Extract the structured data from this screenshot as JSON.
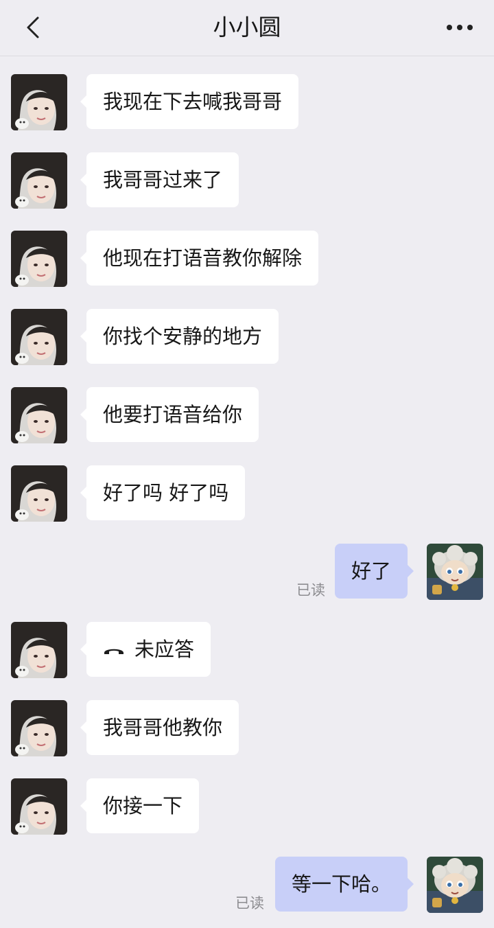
{
  "header": {
    "title": "小小圆",
    "back_icon": "chevron-left-icon",
    "more_icon": "more-horizontal-icon"
  },
  "colors": {
    "background": "#eeedf2",
    "incoming_bubble": "#ffffff",
    "outgoing_bubble": "#c8cff8",
    "read_text": "#8c8c90"
  },
  "messages": [
    {
      "from": "contact",
      "text": "我现在下去喊我哥哥"
    },
    {
      "from": "contact",
      "text": "我哥哥过来了"
    },
    {
      "from": "contact",
      "text": "他现在打语音教你解除"
    },
    {
      "from": "contact",
      "text": "你找个安静的地方"
    },
    {
      "from": "contact",
      "text": "他要打语音给你"
    },
    {
      "from": "contact",
      "text": "好了吗 好了吗"
    },
    {
      "from": "me",
      "text": "好了",
      "status": "已读"
    },
    {
      "from": "contact",
      "text": "未应答",
      "type": "call",
      "icon": "phone-hangup-icon"
    },
    {
      "from": "contact",
      "text": "我哥哥他教你"
    },
    {
      "from": "contact",
      "text": "你接一下"
    },
    {
      "from": "me",
      "text": "等一下哈。",
      "status": "已读"
    }
  ]
}
